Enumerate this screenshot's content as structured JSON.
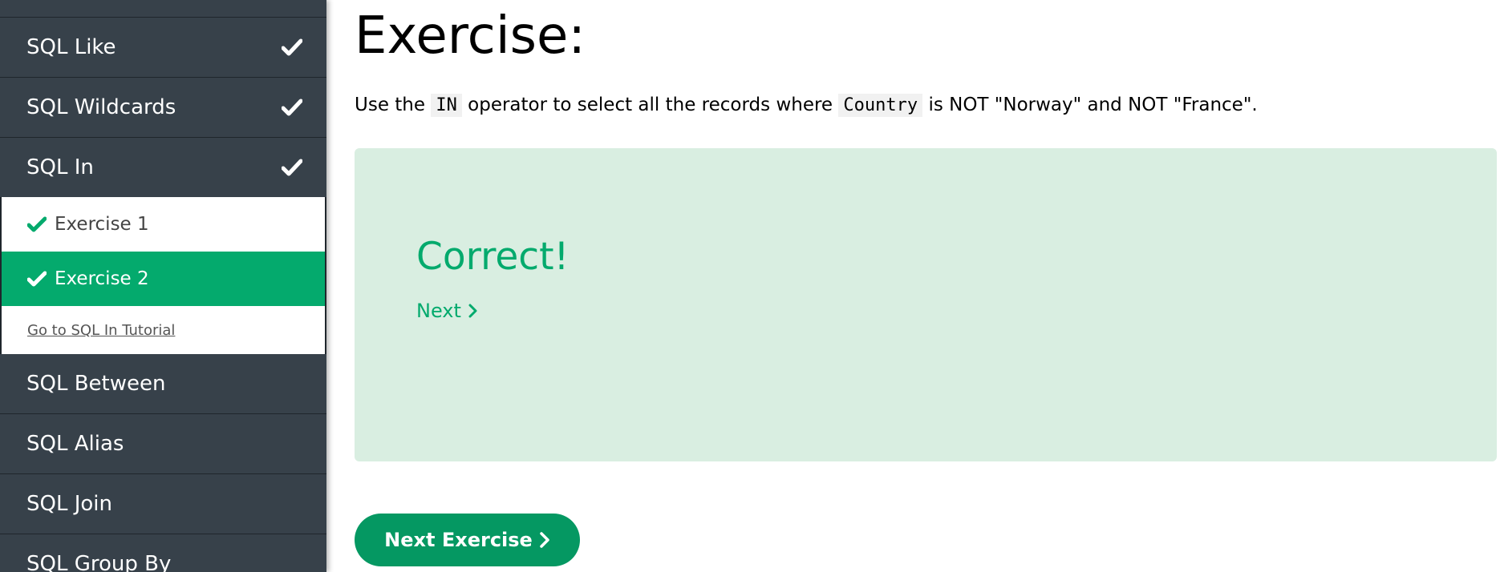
{
  "sidebar": {
    "items_top": [
      {
        "label": "SQL Like",
        "checked": true
      },
      {
        "label": "SQL Wildcards",
        "checked": true
      },
      {
        "label": "SQL In",
        "checked": true
      }
    ],
    "submenu": {
      "exercises": [
        {
          "label": "Exercise 1",
          "checked": true
        },
        {
          "label": "Exercise 2",
          "checked": true,
          "selected": true
        }
      ],
      "tutorial_link": "Go to SQL In Tutorial"
    },
    "items_bottom": [
      {
        "label": "SQL Between"
      },
      {
        "label": "SQL Alias"
      },
      {
        "label": "SQL Join"
      },
      {
        "label": "SQL Group By"
      }
    ],
    "icons": {
      "check": "check-icon"
    }
  },
  "main": {
    "title": "Exercise:",
    "instruction": {
      "part1": "Use the",
      "code1": "IN",
      "part2": "operator to select all the records where",
      "code2": "Country",
      "part3": "is NOT \"Norway\" and NOT \"France\"."
    },
    "result": {
      "title": "Correct!",
      "next_link": "Next"
    },
    "next_exercise_button": "Next Exercise"
  },
  "colors": {
    "sidebar_bg": "#37414a",
    "accent_green": "#04aa6d",
    "button_green": "#059862",
    "result_bg": "#d9eee1"
  }
}
